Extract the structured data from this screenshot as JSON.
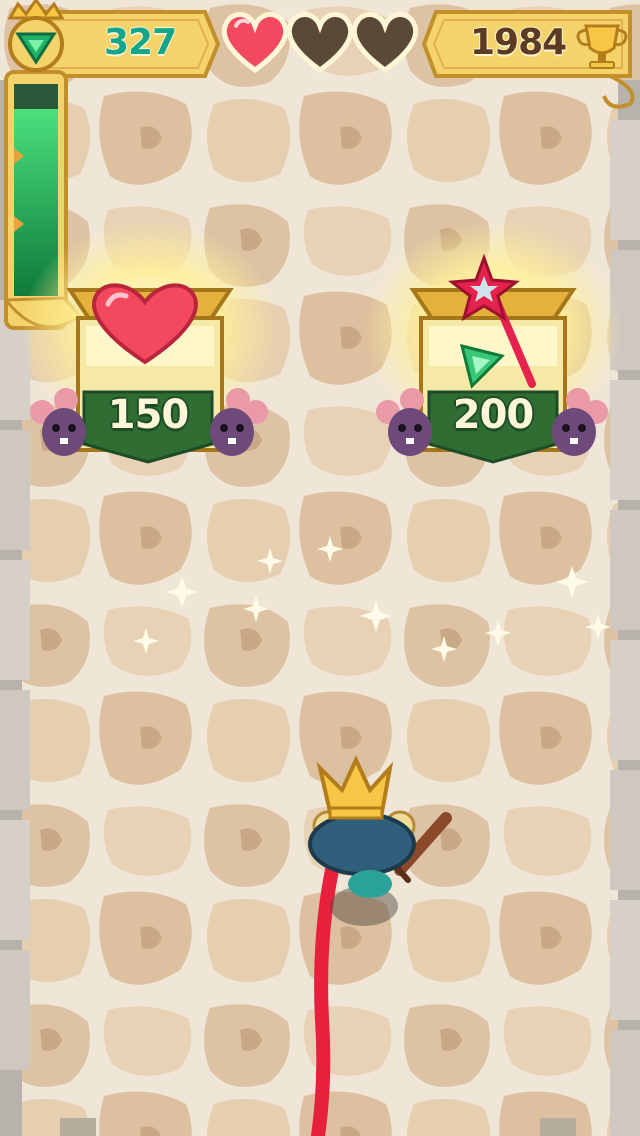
{
  "hud": {
    "gems": "327",
    "score": "1984",
    "hearts": {
      "full": 1,
      "total": 3
    },
    "power_meter_level": 0.88,
    "icons": [
      "crown-gem-icon",
      "heart-icon",
      "trophy-icon"
    ]
  },
  "shop": {
    "items": [
      {
        "name": "heart",
        "price": "150",
        "icon": "heart-icon"
      },
      {
        "name": "magic-wand",
        "price": "200",
        "icon": "magic-wand-icon"
      }
    ]
  },
  "player": {
    "character": "crowned-mouse-knight",
    "weapon": "wooden-sword"
  },
  "colors": {
    "banner_gold": "#f4d36b",
    "gem_green": "#13a68a",
    "heart_red": "#f2495f",
    "ribbon_green": "#2f6d33",
    "path_red": "#e6203d",
    "floor": "#efe3cf"
  }
}
